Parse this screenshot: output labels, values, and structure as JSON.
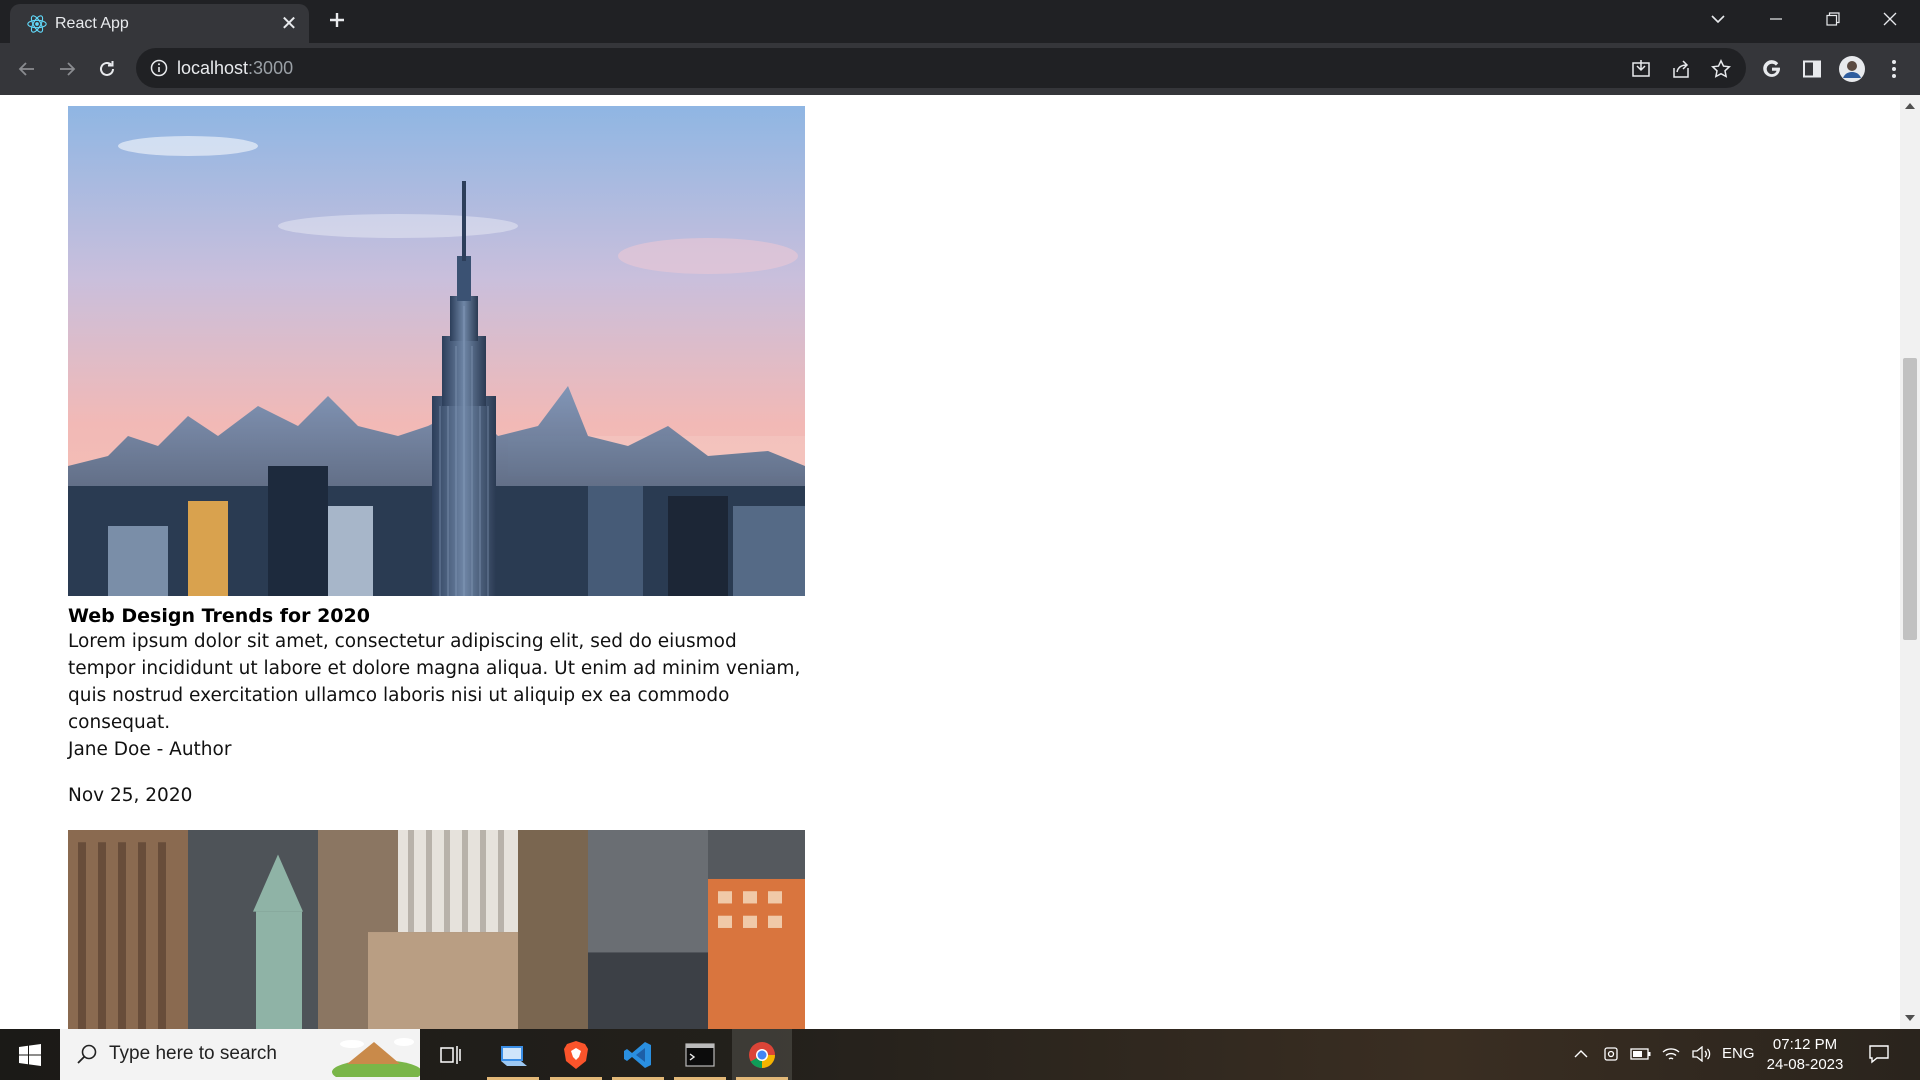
{
  "browser": {
    "tab_title": "React App",
    "url_host": "localhost",
    "url_port": ":3000",
    "icons": {
      "favicon": "react-logo-icon",
      "close": "close-icon",
      "new_tab": "plus-icon",
      "back": "arrow-left-icon",
      "forward": "arrow-right-icon",
      "reload": "reload-icon",
      "info": "info-icon",
      "install": "install-icon",
      "share": "share-icon",
      "bookmark": "star-icon",
      "google": "google-icon",
      "side_panel": "side-panel-icon",
      "profile": "avatar",
      "menu": "kebab-menu-icon"
    }
  },
  "posts": [
    {
      "title": "Web Design Trends for 2020",
      "body": "Lorem ipsum dolor sit amet, consectetur adipiscing elit, sed do eiusmod tempor incididunt ut labore et dolore magna aliqua. Ut enim ad minim veniam, quis nostrud exercitation ullamco laboris nisi ut aliquip ex ea commodo consequat.",
      "author": "Jane Doe - Author",
      "date": "Nov 25, 2020",
      "image": "empire-state-skyline-image"
    },
    {
      "image": "aerial-city-buildings-image"
    }
  ],
  "taskbar": {
    "search_placeholder": "Type here to search",
    "apps": [
      "task-view-icon",
      "file-explorer-icon",
      "brave-browser-icon",
      "vscode-icon",
      "terminal-icon",
      "chrome-icon"
    ],
    "language": "ENG",
    "time": "07:12 PM",
    "date": "24-08-2023"
  },
  "colors": {
    "tabbar": "#202124",
    "toolbar": "#35363a",
    "page_bg": "#ffffff"
  }
}
